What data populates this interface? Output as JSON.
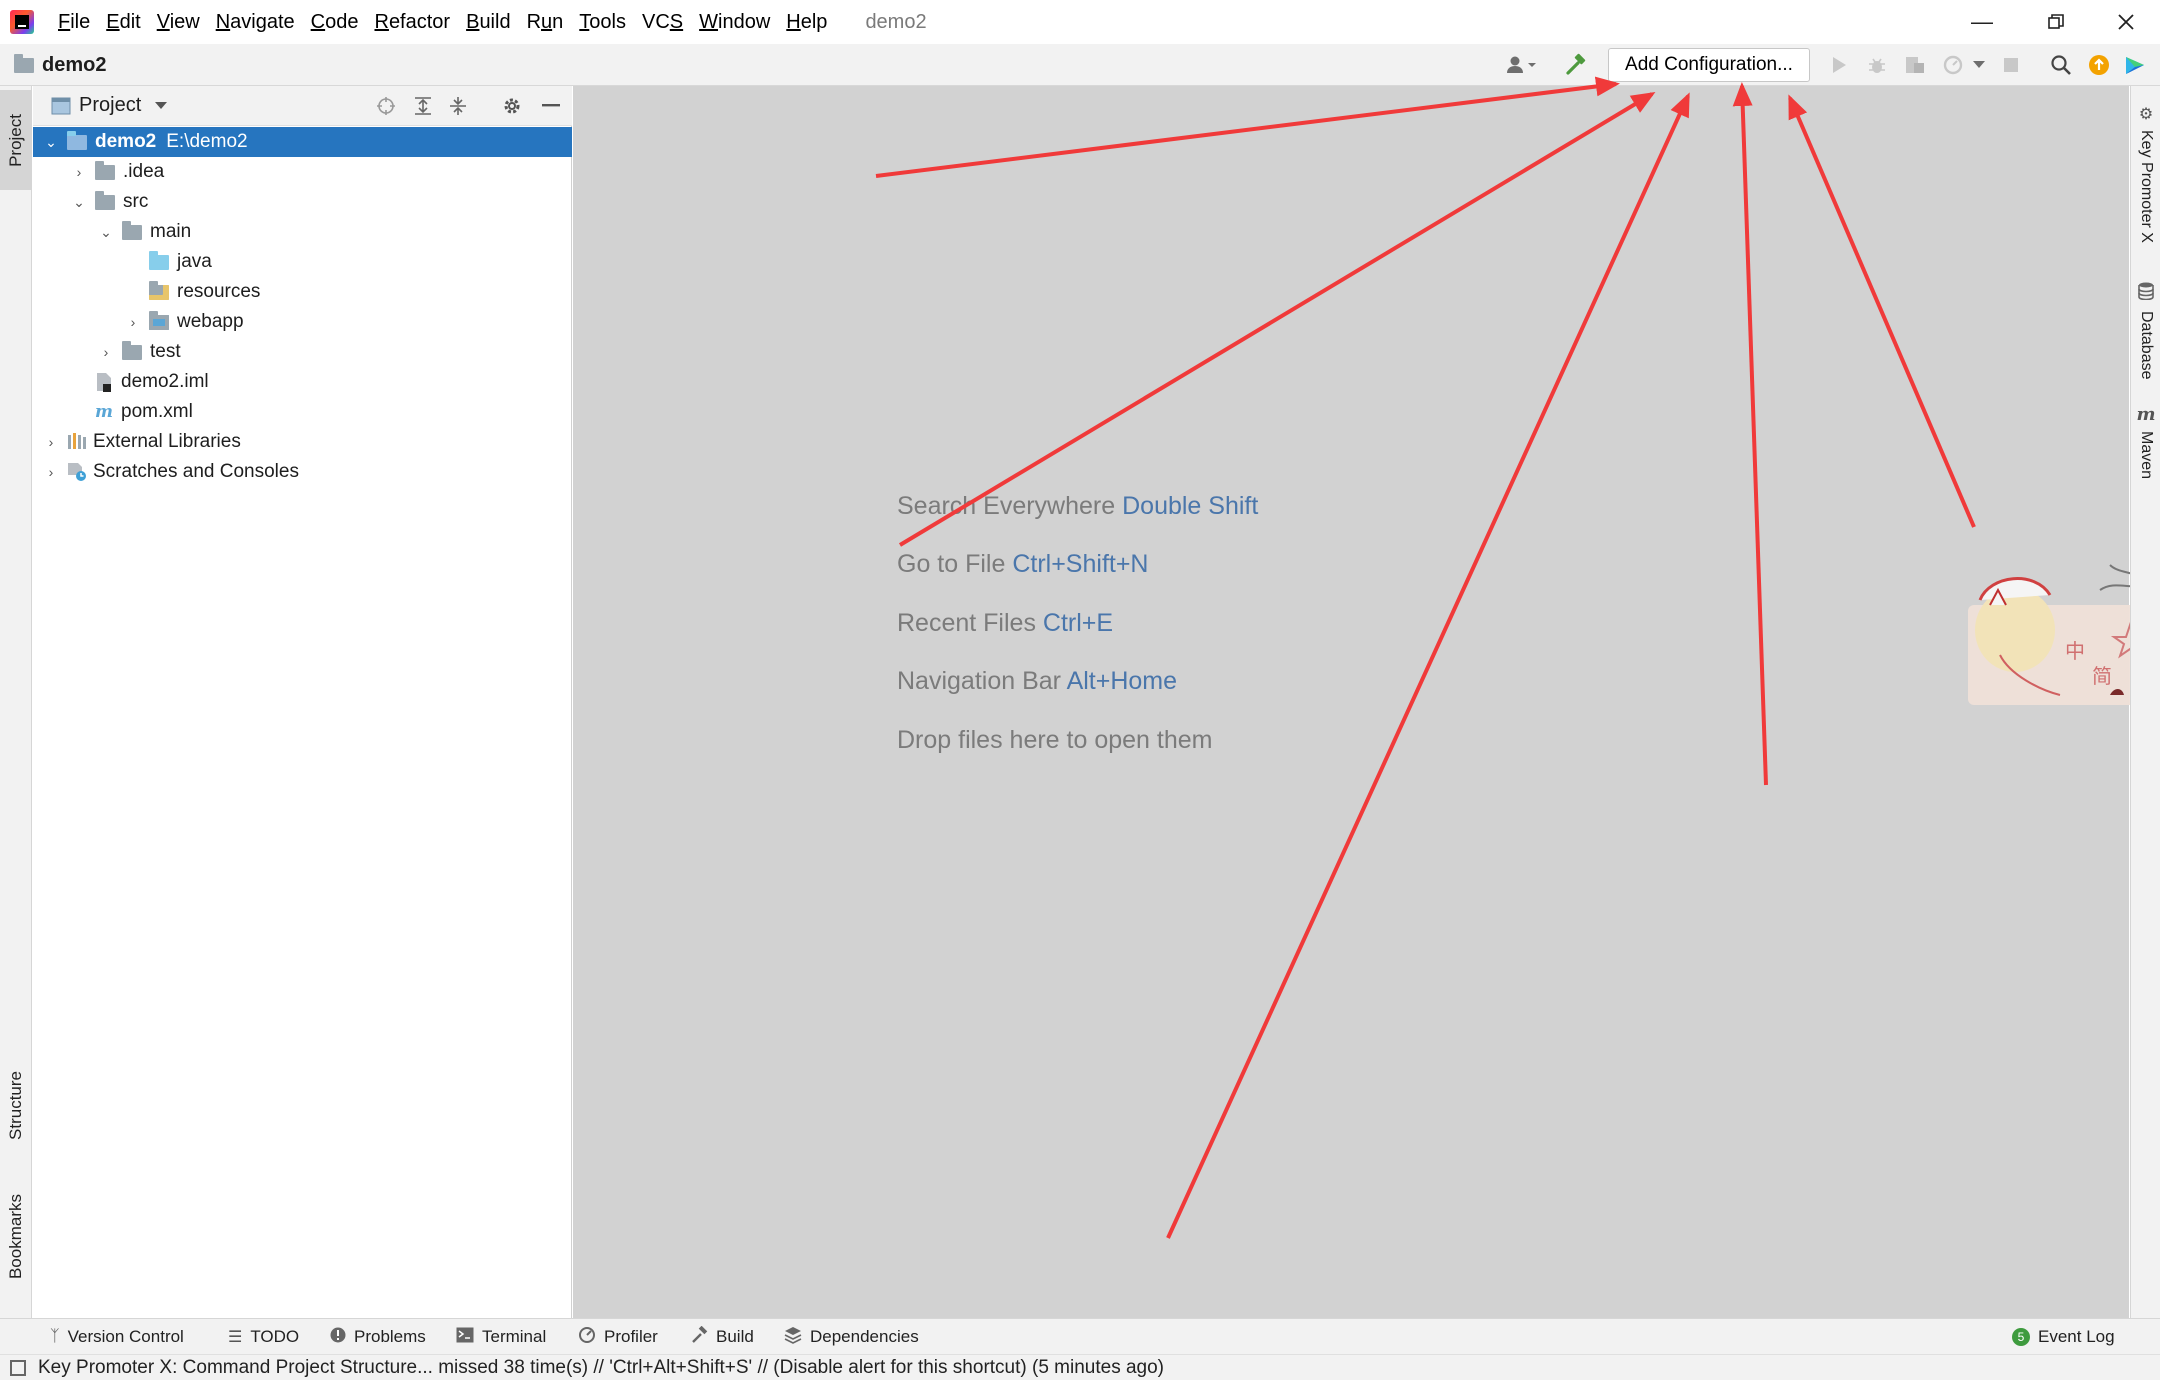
{
  "menu": {
    "items": [
      "File",
      "Edit",
      "View",
      "Navigate",
      "Code",
      "Refactor",
      "Build",
      "Run",
      "Tools",
      "VCS",
      "Window",
      "Help"
    ],
    "mnemonics": [
      "F",
      "E",
      "V",
      "N",
      "C",
      "R",
      "B",
      "u",
      "T",
      "S",
      "W",
      "H"
    ],
    "window_title": "demo2"
  },
  "navbar": {
    "breadcrumb": "demo2",
    "add_configuration": "Add Configuration..."
  },
  "left_strip": {
    "project": "Project",
    "structure": "Structure",
    "bookmarks": "Bookmarks"
  },
  "project_panel": {
    "title": "Project",
    "tree": [
      {
        "label": "demo2",
        "path": "E:\\demo2",
        "level": 0,
        "expanded": true,
        "type": "module",
        "selected": true
      },
      {
        "label": ".idea",
        "level": 1,
        "expanded": false,
        "type": "folder"
      },
      {
        "label": "src",
        "level": 1,
        "expanded": true,
        "type": "folder"
      },
      {
        "label": "main",
        "level": 2,
        "expanded": true,
        "type": "folder"
      },
      {
        "label": "java",
        "level": 3,
        "type": "source-folder"
      },
      {
        "label": "resources",
        "level": 3,
        "type": "resources-folder"
      },
      {
        "label": "webapp",
        "level": 3,
        "expanded": false,
        "type": "web-folder"
      },
      {
        "label": "test",
        "level": 2,
        "expanded": false,
        "type": "folder"
      },
      {
        "label": "demo2.iml",
        "level": 1,
        "type": "iml-file"
      },
      {
        "label": "pom.xml",
        "level": 1,
        "type": "maven-file"
      },
      {
        "label": "External Libraries",
        "level": 0,
        "expanded": false,
        "type": "libraries"
      },
      {
        "label": "Scratches and Consoles",
        "level": 0,
        "expanded": false,
        "type": "scratches"
      }
    ]
  },
  "editor": {
    "hints": [
      {
        "text": "Search Everywhere",
        "key": "Double Shift"
      },
      {
        "text": "Go to File",
        "key": "Ctrl+Shift+N"
      },
      {
        "text": "Recent Files",
        "key": "Ctrl+E"
      },
      {
        "text": "Navigation Bar",
        "key": "Alt+Home"
      },
      {
        "text": "Drop files here to open them",
        "key": ""
      }
    ]
  },
  "right_strip": {
    "key_promoter": "Key Promoter X",
    "database": "Database",
    "maven": "Maven"
  },
  "bottom_bar": {
    "tabs": [
      "Version Control",
      "TODO",
      "Problems",
      "Terminal",
      "Profiler",
      "Build",
      "Dependencies"
    ],
    "event_log": "Event Log",
    "event_count": "5"
  },
  "status": {
    "message": "Key Promoter X: Command Project Structure... missed 38 time(s) // 'Ctrl+Alt+Shift+S' // (Disable alert for this shortcut) (5 minutes ago)"
  },
  "mascot": {
    "chars": [
      "中",
      "简"
    ]
  },
  "colors": {
    "selection": "#2675bf",
    "editor_bg": "#d2d2d2",
    "shortcut": "#4a76ab",
    "annotation_arrow": "#f03a3a"
  }
}
